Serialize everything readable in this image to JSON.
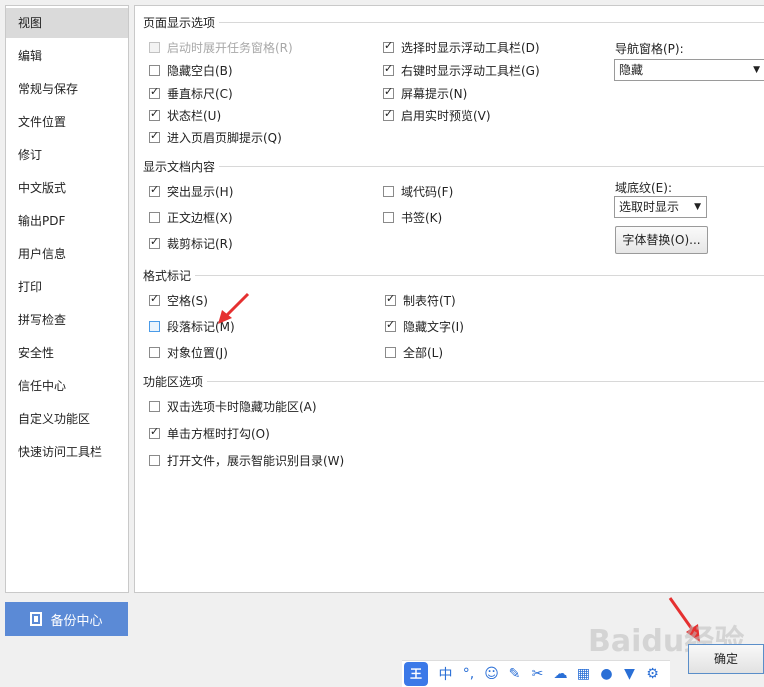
{
  "nav": {
    "items": [
      {
        "label": "视图",
        "active": true
      },
      {
        "label": "编辑"
      },
      {
        "label": "常规与保存"
      },
      {
        "label": "文件位置"
      },
      {
        "label": "修订"
      },
      {
        "label": "中文版式"
      },
      {
        "label": "输出PDF"
      },
      {
        "label": "用户信息"
      },
      {
        "label": "打印"
      },
      {
        "label": "拼写检查"
      },
      {
        "label": "安全性"
      },
      {
        "label": "信任中心"
      },
      {
        "label": "自定义功能区"
      },
      {
        "label": "快速访问工具栏"
      }
    ]
  },
  "sections": {
    "page_display": {
      "title": "页面显示选项",
      "col1": [
        {
          "label": "启动时展开任务窗格(R)",
          "checked": false,
          "disabled": true
        },
        {
          "label": "隐藏空白(B)",
          "checked": false
        },
        {
          "label": "垂直标尺(C)",
          "checked": true
        },
        {
          "label": "状态栏(U)",
          "checked": true
        },
        {
          "label": "进入页眉页脚提示(Q)",
          "checked": true
        }
      ],
      "col2": [
        {
          "label": "选择时显示浮动工具栏(D)",
          "checked": true
        },
        {
          "label": "右键时显示浮动工具栏(G)",
          "checked": true
        },
        {
          "label": "屏幕提示(N)",
          "checked": true
        },
        {
          "label": "启用实时预览(V)",
          "checked": true
        }
      ],
      "nav_pane_label": "导航窗格(P):",
      "nav_pane_value": "隐藏"
    },
    "doc_content": {
      "title": "显示文档内容",
      "col1": [
        {
          "label": "突出显示(H)",
          "checked": true
        },
        {
          "label": "正文边框(X)",
          "checked": false
        },
        {
          "label": "裁剪标记(R)",
          "checked": true
        }
      ],
      "col2": [
        {
          "label": "域代码(F)",
          "checked": false
        },
        {
          "label": "书签(K)",
          "checked": false
        }
      ],
      "field_shading_label": "域底纹(E):",
      "field_shading_value": "选取时显示",
      "font_replace_label": "字体替换(O)..."
    },
    "format_marks": {
      "title": "格式标记",
      "col1": [
        {
          "label": "空格(S)",
          "checked": true
        },
        {
          "label": "段落标记(M)",
          "checked": false,
          "highlight": true
        },
        {
          "label": "对象位置(J)",
          "checked": false
        }
      ],
      "col2": [
        {
          "label": "制表符(T)",
          "checked": true
        },
        {
          "label": "隐藏文字(I)",
          "checked": true
        },
        {
          "label": "全部(L)",
          "checked": false
        }
      ]
    },
    "ribbon": {
      "title": "功能区选项",
      "items": [
        {
          "label": "双击选项卡时隐藏功能区(A)",
          "checked": false
        },
        {
          "label": "单击方框时打勾(O)",
          "checked": true
        },
        {
          "label": "打开文件，展示智能识别目录(W)",
          "checked": false
        }
      ]
    }
  },
  "footer": {
    "backup_label": "备份中心",
    "ok_label": "确定"
  },
  "ime": {
    "logo": "王",
    "mode": "中"
  },
  "watermark": "Baidu经验"
}
